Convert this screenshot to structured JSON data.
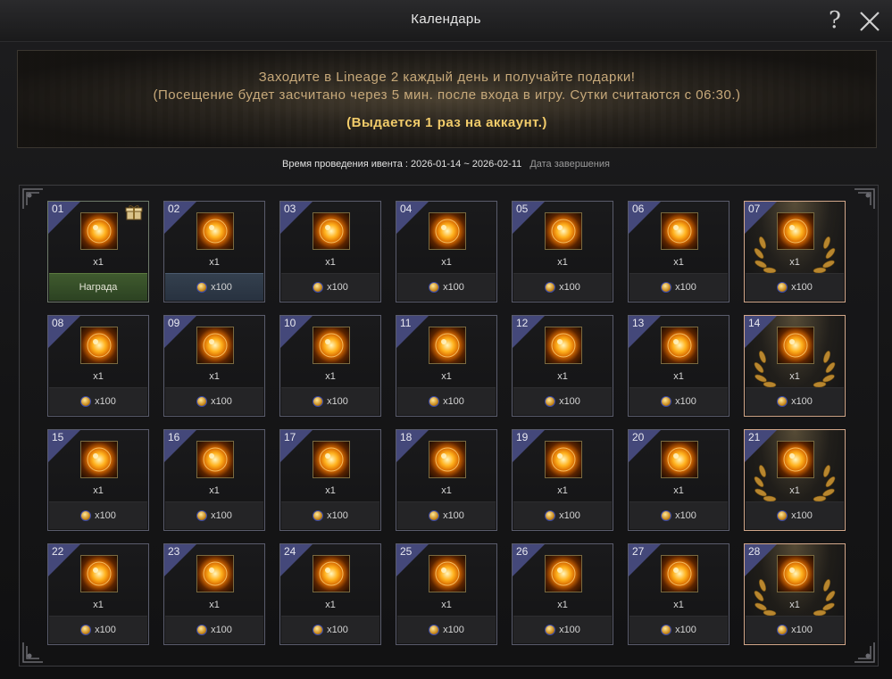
{
  "window": {
    "title": "Календарь",
    "help_glyph": "?",
    "close_icon": "close-icon"
  },
  "banner": {
    "line1": "Заходите в Lineage 2 каждый день и получайте подарки!",
    "line2": "(Посещение будет засчитано через 5 мин. после входа в игру. Сутки считаются с 06:30.)",
    "line3": "(Выдается 1 раз на аккаунт.)"
  },
  "period": {
    "label": "Время проведения ивента : 2026-01-14 ~ 2026-02-11",
    "end_label": "Дата завершения"
  },
  "colors": {
    "accent_gold": "#f2cc6a",
    "banner_text": "#c7a97a",
    "day_badge": "#44487a",
    "claim_green": "#3f5a2e",
    "special_border": "#d2a78a"
  },
  "days": [
    {
      "num": "01",
      "qty": "x1",
      "bonus": "Награда",
      "state": "claim",
      "gift": true,
      "special": false
    },
    {
      "num": "02",
      "qty": "x1",
      "bonus": "x100",
      "state": "highlight",
      "gift": false,
      "special": false
    },
    {
      "num": "03",
      "qty": "x1",
      "bonus": "x100",
      "state": "normal",
      "gift": false,
      "special": false
    },
    {
      "num": "04",
      "qty": "x1",
      "bonus": "x100",
      "state": "normal",
      "gift": false,
      "special": false
    },
    {
      "num": "05",
      "qty": "x1",
      "bonus": "x100",
      "state": "normal",
      "gift": false,
      "special": false
    },
    {
      "num": "06",
      "qty": "x1",
      "bonus": "x100",
      "state": "normal",
      "gift": false,
      "special": false
    },
    {
      "num": "07",
      "qty": "x1",
      "bonus": "x100",
      "state": "normal",
      "gift": false,
      "special": true
    },
    {
      "num": "08",
      "qty": "x1",
      "bonus": "x100",
      "state": "normal",
      "gift": false,
      "special": false
    },
    {
      "num": "09",
      "qty": "x1",
      "bonus": "x100",
      "state": "normal",
      "gift": false,
      "special": false
    },
    {
      "num": "10",
      "qty": "x1",
      "bonus": "x100",
      "state": "normal",
      "gift": false,
      "special": false
    },
    {
      "num": "11",
      "qty": "x1",
      "bonus": "x100",
      "state": "normal",
      "gift": false,
      "special": false
    },
    {
      "num": "12",
      "qty": "x1",
      "bonus": "x100",
      "state": "normal",
      "gift": false,
      "special": false
    },
    {
      "num": "13",
      "qty": "x1",
      "bonus": "x100",
      "state": "normal",
      "gift": false,
      "special": false
    },
    {
      "num": "14",
      "qty": "x1",
      "bonus": "x100",
      "state": "normal",
      "gift": false,
      "special": true
    },
    {
      "num": "15",
      "qty": "x1",
      "bonus": "x100",
      "state": "normal",
      "gift": false,
      "special": false
    },
    {
      "num": "16",
      "qty": "x1",
      "bonus": "x100",
      "state": "normal",
      "gift": false,
      "special": false
    },
    {
      "num": "17",
      "qty": "x1",
      "bonus": "x100",
      "state": "normal",
      "gift": false,
      "special": false
    },
    {
      "num": "18",
      "qty": "x1",
      "bonus": "x100",
      "state": "normal",
      "gift": false,
      "special": false
    },
    {
      "num": "19",
      "qty": "x1",
      "bonus": "x100",
      "state": "normal",
      "gift": false,
      "special": false
    },
    {
      "num": "20",
      "qty": "x1",
      "bonus": "x100",
      "state": "normal",
      "gift": false,
      "special": false
    },
    {
      "num": "21",
      "qty": "x1",
      "bonus": "x100",
      "state": "normal",
      "gift": false,
      "special": true
    },
    {
      "num": "22",
      "qty": "x1",
      "bonus": "x100",
      "state": "normal",
      "gift": false,
      "special": false
    },
    {
      "num": "23",
      "qty": "x1",
      "bonus": "x100",
      "state": "normal",
      "gift": false,
      "special": false
    },
    {
      "num": "24",
      "qty": "x1",
      "bonus": "x100",
      "state": "normal",
      "gift": false,
      "special": false
    },
    {
      "num": "25",
      "qty": "x1",
      "bonus": "x100",
      "state": "normal",
      "gift": false,
      "special": false
    },
    {
      "num": "26",
      "qty": "x1",
      "bonus": "x100",
      "state": "normal",
      "gift": false,
      "special": false
    },
    {
      "num": "27",
      "qty": "x1",
      "bonus": "x100",
      "state": "normal",
      "gift": false,
      "special": false
    },
    {
      "num": "28",
      "qty": "x1",
      "bonus": "x100",
      "state": "normal",
      "gift": false,
      "special": true
    }
  ]
}
